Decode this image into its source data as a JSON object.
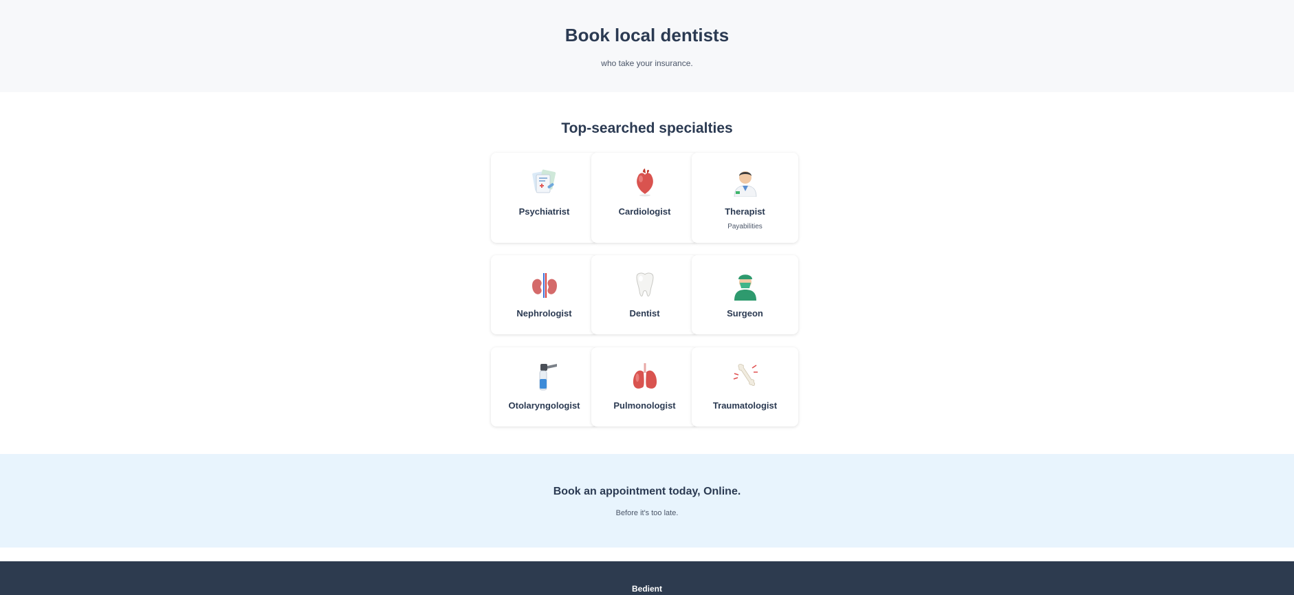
{
  "hero": {
    "title": "Book local dentists",
    "subtitle": "who take your insurance."
  },
  "specialties": {
    "title": "Top-searched specialties",
    "items": [
      {
        "label": "Psychiatrist",
        "icon": "prescription-icon"
      },
      {
        "label": "Cardiologist",
        "icon": "heart-icon"
      },
      {
        "label": "Therapist",
        "icon": "doctor-icon",
        "sub": "Payabilities"
      },
      {
        "label": "Nephrologist",
        "icon": "kidneys-icon"
      },
      {
        "label": "Dentist",
        "icon": "tooth-icon"
      },
      {
        "label": "Surgeon",
        "icon": "surgeon-icon"
      },
      {
        "label": "Otolaryngologist",
        "icon": "otoscope-icon"
      },
      {
        "label": "Pulmonologist",
        "icon": "lungs-icon"
      },
      {
        "label": "Traumatologist",
        "icon": "bone-icon"
      }
    ]
  },
  "cta": {
    "title": "Book an appointment today, Online.",
    "subtitle": "Before it's too late."
  },
  "footer": {
    "brand": "Bedient"
  }
}
